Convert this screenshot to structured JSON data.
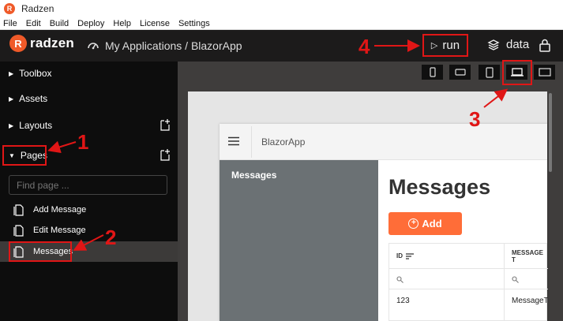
{
  "window": {
    "title": "Radzen",
    "logo_letter": "R"
  },
  "menu": [
    "File",
    "Edit",
    "Build",
    "Deploy",
    "Help",
    "License",
    "Settings"
  ],
  "header": {
    "logo_text": "radzen",
    "logo_letter": "R",
    "breadcrumb": "My Applications / BlazorApp",
    "run_label": "run",
    "data_label": "data"
  },
  "sidebar": {
    "sections": [
      {
        "label": "Toolbox"
      },
      {
        "label": "Assets"
      },
      {
        "label": "Layouts"
      },
      {
        "label": "Pages"
      }
    ],
    "search_placeholder": "Find page ...",
    "pages": [
      "Add Message",
      "Edit Message",
      "Messages"
    ],
    "selected_page": "Messages"
  },
  "devices": [
    "phone",
    "phone-landscape",
    "tablet",
    "laptop",
    "desktop"
  ],
  "selected_device": "laptop",
  "preview": {
    "app_name": "BlazorApp",
    "nav_item": "Messages",
    "heading": "Messages",
    "add_button": "Add",
    "grid": {
      "columns": [
        "ID",
        "MESSAGE T"
      ],
      "rows": [
        [
          "123",
          "MessageT"
        ]
      ]
    }
  },
  "annotations": [
    "1",
    "2",
    "3",
    "4"
  ],
  "colors": {
    "accent": "#ef5a29",
    "annotation": "#e01616",
    "add_button": "#ff6d38",
    "header_bg": "#1c1b1b"
  }
}
